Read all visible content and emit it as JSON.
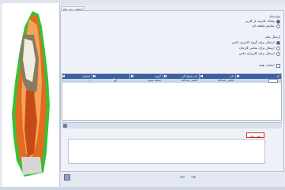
{
  "tab": {
    "label": "انتخاب نوع پیام"
  },
  "options": {
    "send_type_title": "نوع پیام",
    "send_type": [
      {
        "label": "پیامک کارمند از کاربر",
        "selected": true
      },
      {
        "label": "نمایش قطعه ای",
        "selected": false
      }
    ],
    "recipients_title": "ارسال پیام",
    "recipients": [
      {
        "label": "ارسال برای گروه کاربری خاص",
        "selected": true
      },
      {
        "label": "ارسال برای تماس کارمان",
        "selected": false
      },
      {
        "label": "ارسال برای کاربران خاص",
        "selected": false
      }
    ],
    "select_all": "انتخاب همه"
  },
  "grid": {
    "columns": [
      "کد",
      "نام",
      "نام خانوادگی",
      "گروه",
      "",
      "شماره"
    ],
    "row": [
      "",
      "قاضی عبدالله",
      "قاضی عبدالله",
      "محمد نجفی",
      "",
      "۱"
    ]
  },
  "message": {
    "label": "متن پیام",
    "value": ""
  },
  "colors": {
    "grid_header": "#3c5fa1",
    "selected_row": "#c9d6ea",
    "highlight_border": "#d32a2a"
  },
  "icons": {
    "left_image": "paint-brush-image",
    "toolbar": "grid-icon",
    "footer": "save-icon",
    "nav_prev": "arrow-left-icon",
    "nav_next": "arrow-right-icon"
  }
}
